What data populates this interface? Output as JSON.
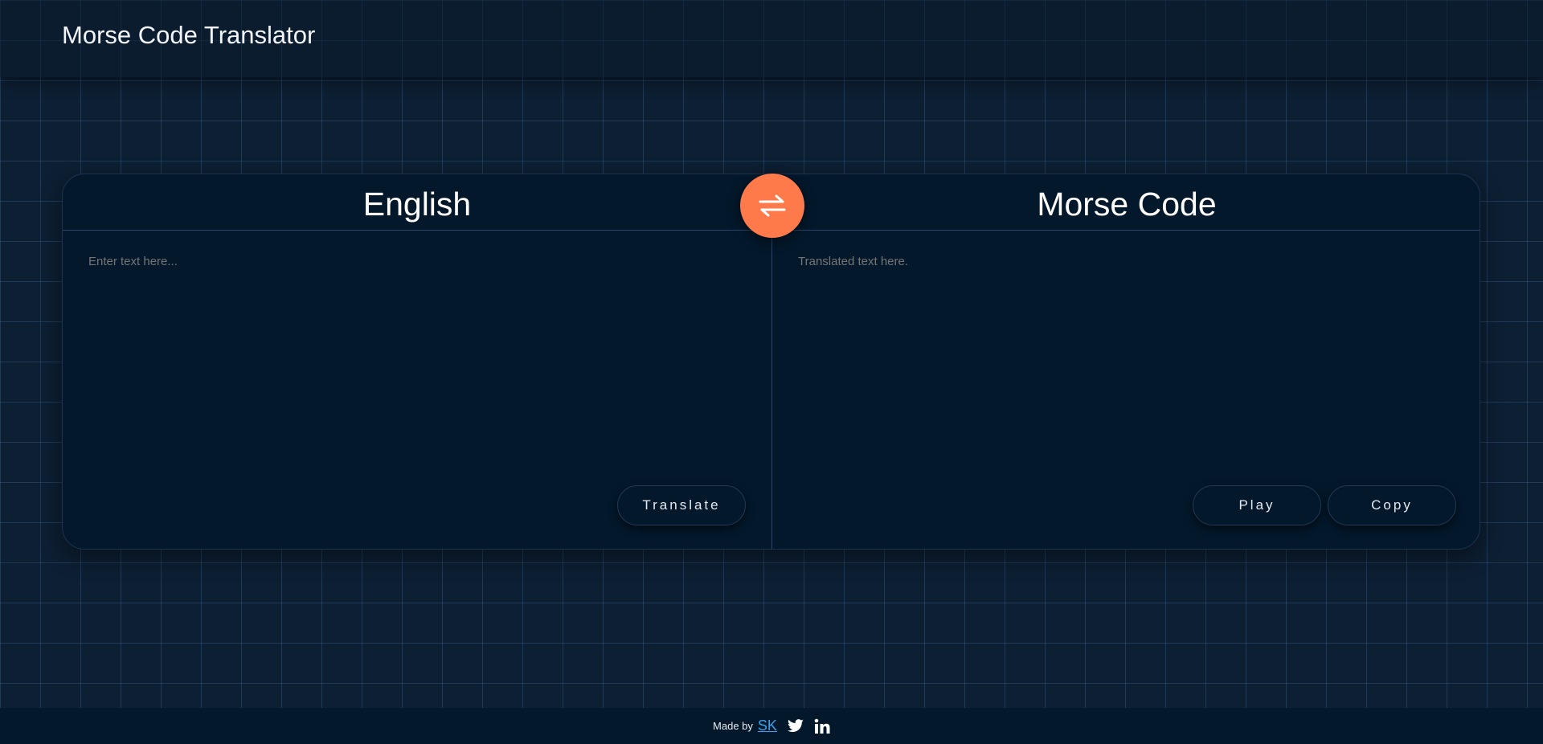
{
  "header": {
    "title": "Morse Code Translator"
  },
  "translator": {
    "source_language": "English",
    "target_language": "Morse Code",
    "swap_icon": "swap-arrows-icon",
    "input_placeholder": "Enter text here...",
    "output_placeholder": "Translated text here.",
    "translate_label": "Translate",
    "play_label": "Play",
    "copy_label": "Copy"
  },
  "footer": {
    "made_by": "Made by",
    "author": "SK",
    "social_icons": [
      "twitter-icon",
      "linkedin-icon"
    ]
  },
  "colors": {
    "background": "#0d1f33",
    "card": "#03182b",
    "accent": "#ff7a4a",
    "link": "#3aa0e8",
    "placeholder": "#7e8a97"
  }
}
